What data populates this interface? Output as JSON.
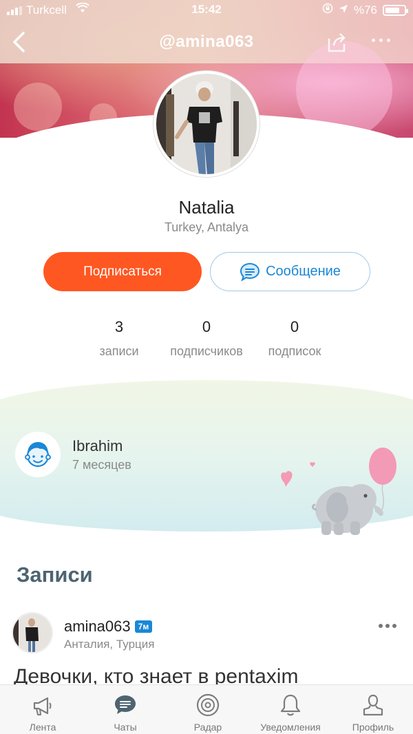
{
  "status_bar": {
    "carrier": "Turkcell",
    "time": "15:42",
    "battery": "%76",
    "battery_level": 0.76
  },
  "nav": {
    "title": "@amina063"
  },
  "profile": {
    "name": "Natalia",
    "location": "Turkey, Antalya",
    "subscribe_label": "Подписаться",
    "message_label": "Сообщение",
    "stats": [
      {
        "value": "3",
        "label": "записи"
      },
      {
        "value": "0",
        "label": "подписчиков"
      },
      {
        "value": "0",
        "label": "подписок"
      }
    ]
  },
  "visitor": {
    "name": "Ibrahim",
    "time": "7 месяцев"
  },
  "posts_section": {
    "title": "Записи",
    "post": {
      "username": "amina063",
      "badge": "7м",
      "location": "Анталия, Турция",
      "text": "Девочки, кто знает в pentaxim"
    }
  },
  "tabbar": {
    "items": [
      {
        "label": "Лента",
        "icon": "megaphone-icon"
      },
      {
        "label": "Чаты",
        "icon": "chat-bubble-icon"
      },
      {
        "label": "Радар",
        "icon": "radar-icon"
      },
      {
        "label": "Уведомления",
        "icon": "bell-icon"
      },
      {
        "label": "Профиль",
        "icon": "profile-icon"
      }
    ]
  },
  "colors": {
    "accent_orange": "#ff5722",
    "accent_blue": "#1b87d6",
    "heading": "#4d6470"
  }
}
